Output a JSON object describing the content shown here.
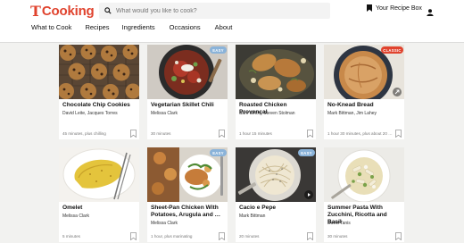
{
  "header": {
    "logo_mark": "T",
    "logo_text": "Cooking",
    "search_placeholder": "What would you like to cook?",
    "recipe_box_label": "Your Recipe Box"
  },
  "nav": [
    {
      "label": "What to Cook"
    },
    {
      "label": "Recipes"
    },
    {
      "label": "Ingredients"
    },
    {
      "label": "Occasions"
    },
    {
      "label": "About"
    }
  ],
  "badges": {
    "easy": "EASY",
    "classic": "CLASSIC"
  },
  "cards": [
    {
      "title": "Chocolate Chip Cookies",
      "author": "David Leite, Jacques Torres",
      "time": "45 minutes, plus chilling",
      "image": "cookies"
    },
    {
      "title": "Vegetarian Skillet Chili",
      "author": "Melissa Clark",
      "time": "30 minutes",
      "image": "chili",
      "badge": "EASY"
    },
    {
      "title": "Roasted Chicken Provençal",
      "author": "Sam Sifton, Steven Stolman",
      "time": "1 hour 15 minutes",
      "image": "chicken"
    },
    {
      "title": "No-Knead Bread",
      "author": "Mark Bittman, Jim Lahey",
      "time": "1 hour 30 minutes, plus about 20 …",
      "image": "bread",
      "badge": "CLASSIC"
    },
    {
      "title": "Omelet",
      "author": "Melissa Clark",
      "time": "5 minutes",
      "image": "omelet"
    },
    {
      "title": "Sheet-Pan Chicken With Potatoes, Arugula and …",
      "author": "Melissa Clark",
      "time": "1 hour, plus marinating",
      "image": "sheetpan",
      "badge": "EASY"
    },
    {
      "title": "Cacio e Pepe",
      "author": "Mark Bittman",
      "time": "20 minutes",
      "image": "pasta",
      "badge": "EASY"
    },
    {
      "title": "Summer Pasta With Zucchini, Ricotta and Basil",
      "author": "David Tanis",
      "time": "30 minutes",
      "image": "summerpasta"
    }
  ],
  "colors": {
    "brand": "#e0432e",
    "easy_badge": "#8ab3d9",
    "classic_badge": "#e0432e"
  }
}
